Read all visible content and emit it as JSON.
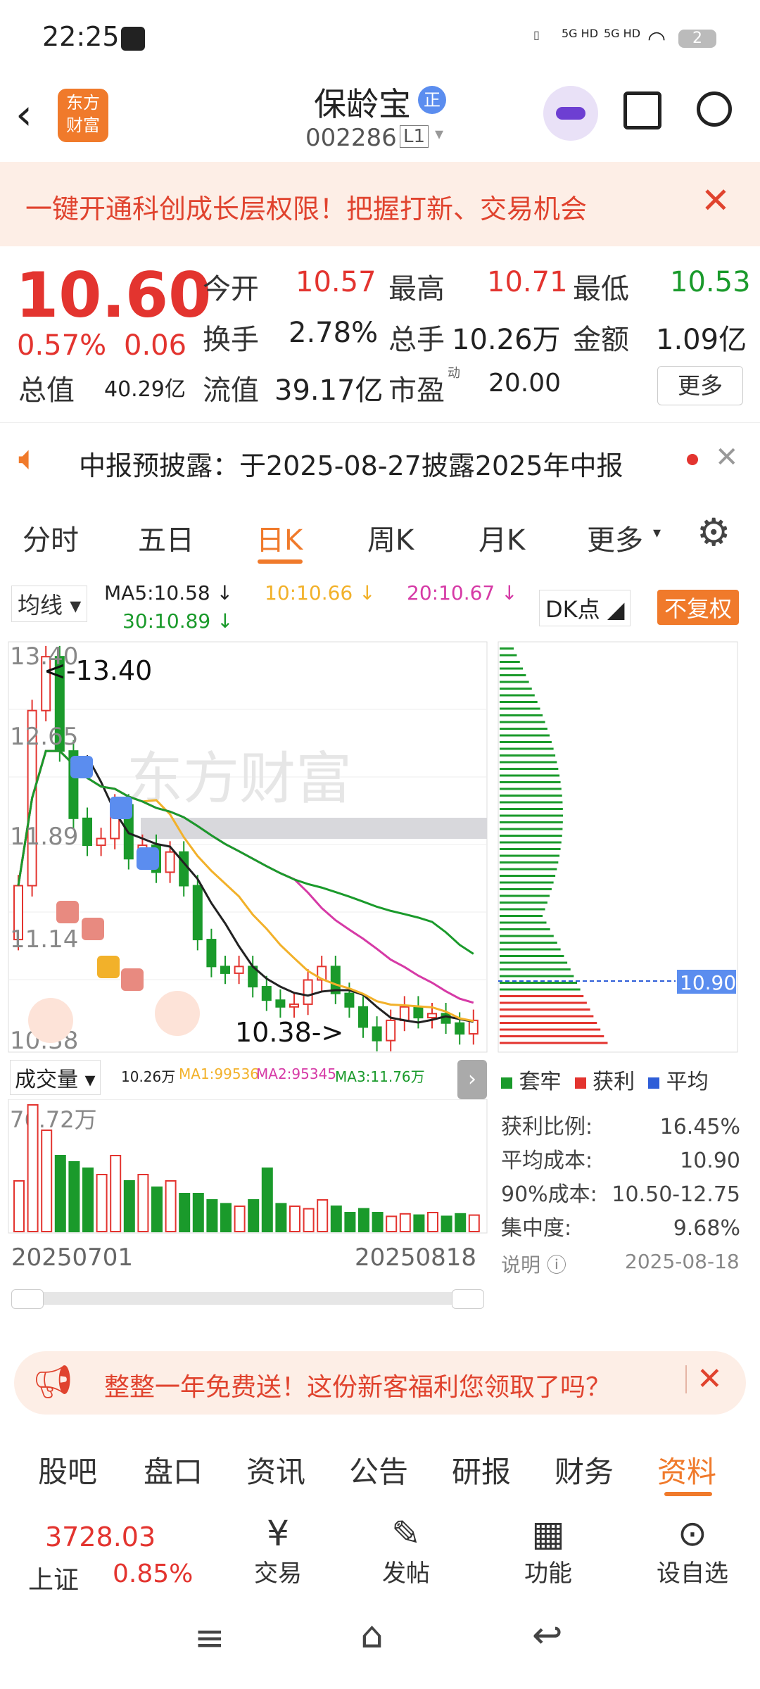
{
  "status_bar": {
    "time": "22:25",
    "network1": "5G HD",
    "network2": "5G HD",
    "battery": "2"
  },
  "header": {
    "logo_line1": "东方",
    "logo_line2": "财富",
    "stock_name": "保龄宝",
    "badge": "正",
    "stock_code": "002286",
    "level": "L1"
  },
  "banner": {
    "text": "一键开通科创成长层权限！把握打新、交易机会"
  },
  "quote": {
    "price": "10.60",
    "change_pct": "0.57%",
    "change": "0.06",
    "open_label": "今开",
    "open": "10.57",
    "high_label": "最高",
    "high": "10.71",
    "low_label": "最低",
    "low": "10.53",
    "turnover_label": "换手",
    "turnover": "2.78%",
    "volume_label": "总手",
    "volume": "10.26万",
    "amount_label": "金额",
    "amount": "1.09亿",
    "mktcap_label": "总值",
    "mktcap": "40.29亿",
    "float_label": "流值",
    "float": "39.17亿",
    "pe_label": "市盈",
    "pe_sup": "动",
    "pe": "20.00",
    "more": "更多"
  },
  "notice": {
    "text": "中报预披露：于2025-08-27披露2025年中报"
  },
  "tabs": [
    "分时",
    "五日",
    "日K",
    "周K",
    "月K",
    "更多"
  ],
  "active_tab": "日K",
  "ma": {
    "selector": "均线",
    "ma5": "MA5:10.58",
    "ma10": "10:10.66",
    "ma20": "20:10.67",
    "ma30": "30:10.89",
    "dk": "DK点",
    "fq": "不复权"
  },
  "chart_data": {
    "type": "candlestick",
    "y_labels": [
      "13.40",
      "12.65",
      "11.89",
      "11.14",
      "10.38"
    ],
    "high_marker": "<-13.40",
    "low_marker": "10.38->",
    "watermark": "东方财富",
    "x_start": "20250701",
    "x_end": "20250818",
    "volume_label": "成交量",
    "volume_stats": {
      "vol": "10.26万",
      "ma1": "MA1:99536",
      "ma2": "MA2:95345",
      "ma3": "MA3:11.76万"
    },
    "volume_max": "76.72万",
    "cost_marker": "10.90",
    "ylim": [
      10.38,
      13.4
    ]
  },
  "chip": {
    "legend": [
      "套牢",
      "获利",
      "平均"
    ],
    "profit_label": "获利比例:",
    "profit": "16.45%",
    "avg_label": "平均成本:",
    "avg": "10.90",
    "cost90_label": "90%成本:",
    "cost90": "10.50-12.75",
    "conc_label": "集中度:",
    "conc": "9.68%",
    "explain": "说明",
    "date": "2025-08-18"
  },
  "promo": {
    "text": "整整一年免费送！这份新客福利您领取了吗？"
  },
  "subtabs": [
    "股吧",
    "盘口",
    "资讯",
    "公告",
    "研报",
    "财务",
    "资料"
  ],
  "active_subtab": "资料",
  "bottom": {
    "index_value": "3728.03",
    "index_name": "上证",
    "index_change": "0.85%",
    "trade": "交易",
    "post": "发帖",
    "func": "功能",
    "watch": "设自选"
  },
  "colors": {
    "up": "#e3342f",
    "down": "#1a9a2b",
    "accent": "#f07a2b",
    "ma10": "#f2b12a",
    "ma20": "#d63aa6",
    "ma30": "#1a9a2b"
  }
}
